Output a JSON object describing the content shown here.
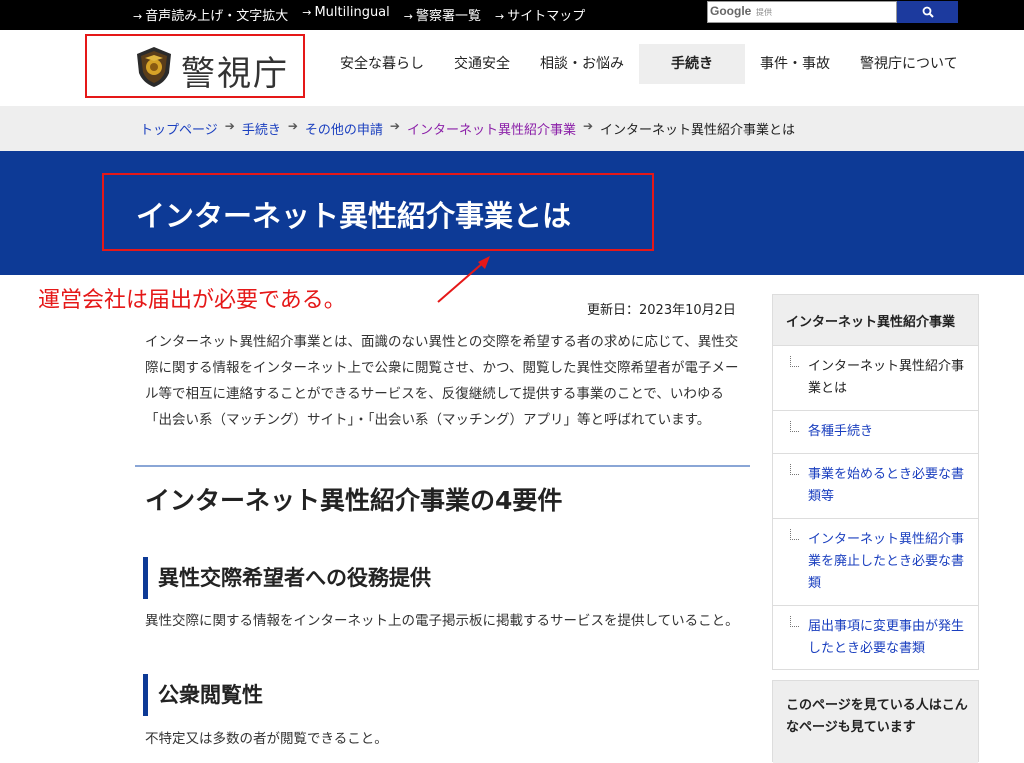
{
  "utility_nav": {
    "links": [
      {
        "label": "音声読み上げ・文字拡大"
      },
      {
        "label": "Multilingual"
      },
      {
        "label": "警察署一覧"
      },
      {
        "label": "サイトマップ"
      }
    ],
    "search": {
      "google_label": "Google",
      "provided_label": "提供",
      "button_icon": "search-icon"
    }
  },
  "header": {
    "logo_text": "警視庁",
    "nav": [
      {
        "label": "安全な暮らし"
      },
      {
        "label": "交通安全"
      },
      {
        "label": "相談・お悩み"
      },
      {
        "label": "手続き",
        "active": true
      },
      {
        "label": "事件・事故"
      },
      {
        "label": "警視庁について"
      }
    ]
  },
  "breadcrumb": {
    "items": [
      {
        "label": "トップページ"
      },
      {
        "label": "手続き"
      },
      {
        "label": "その他の申請"
      },
      {
        "label": "インターネット異性紹介事業"
      }
    ],
    "current": "インターネット異性紹介事業とは"
  },
  "page": {
    "title": "インターネット異性紹介事業とは",
    "annotation": "運営会社は届出が必要である。",
    "updated": "更新日：2023年10月2日",
    "intro": "インターネット異性紹介事業とは、面識のない異性との交際を希望する者の求めに応じて、異性交際に関する情報をインターネット上で公衆に閲覧させ、かつ、閲覧した異性交際希望者が電子メール等で相互に連絡することができるサービスを、反復継続して提供する事業のことで、いわゆる「出会い系（マッチング）サイト」・「出会い系（マッチング）アプリ」等と呼ばれています。",
    "h2": "インターネット異性紹介事業の4要件",
    "sections": [
      {
        "heading": "異性交際希望者への役務提供",
        "text": "異性交際に関する情報をインターネット上の電子掲示板に掲載するサービスを提供していること。"
      },
      {
        "heading": "公衆閲覧性",
        "text": "不特定又は多数の者が閲覧できること。"
      }
    ]
  },
  "sidebar": {
    "heading": "インターネット異性紹介事業",
    "items": [
      {
        "label": "インターネット異性紹介事業とは",
        "current": true
      },
      {
        "label": "各種手続き"
      },
      {
        "label": "事業を始めるとき必要な書類等"
      },
      {
        "label": "インターネット異性紹介事業を廃止したとき必要な書類"
      },
      {
        "label": "届出事項に変更事由が発生したとき必要な書類"
      }
    ],
    "related_heading": "このページを見ている人はこんなページも見ています"
  },
  "colors": {
    "brand_blue": "#0d3a96",
    "highlight_red": "#e51818",
    "link_blue": "#1a3fbf",
    "visited_purple": "#8b1fa8"
  }
}
